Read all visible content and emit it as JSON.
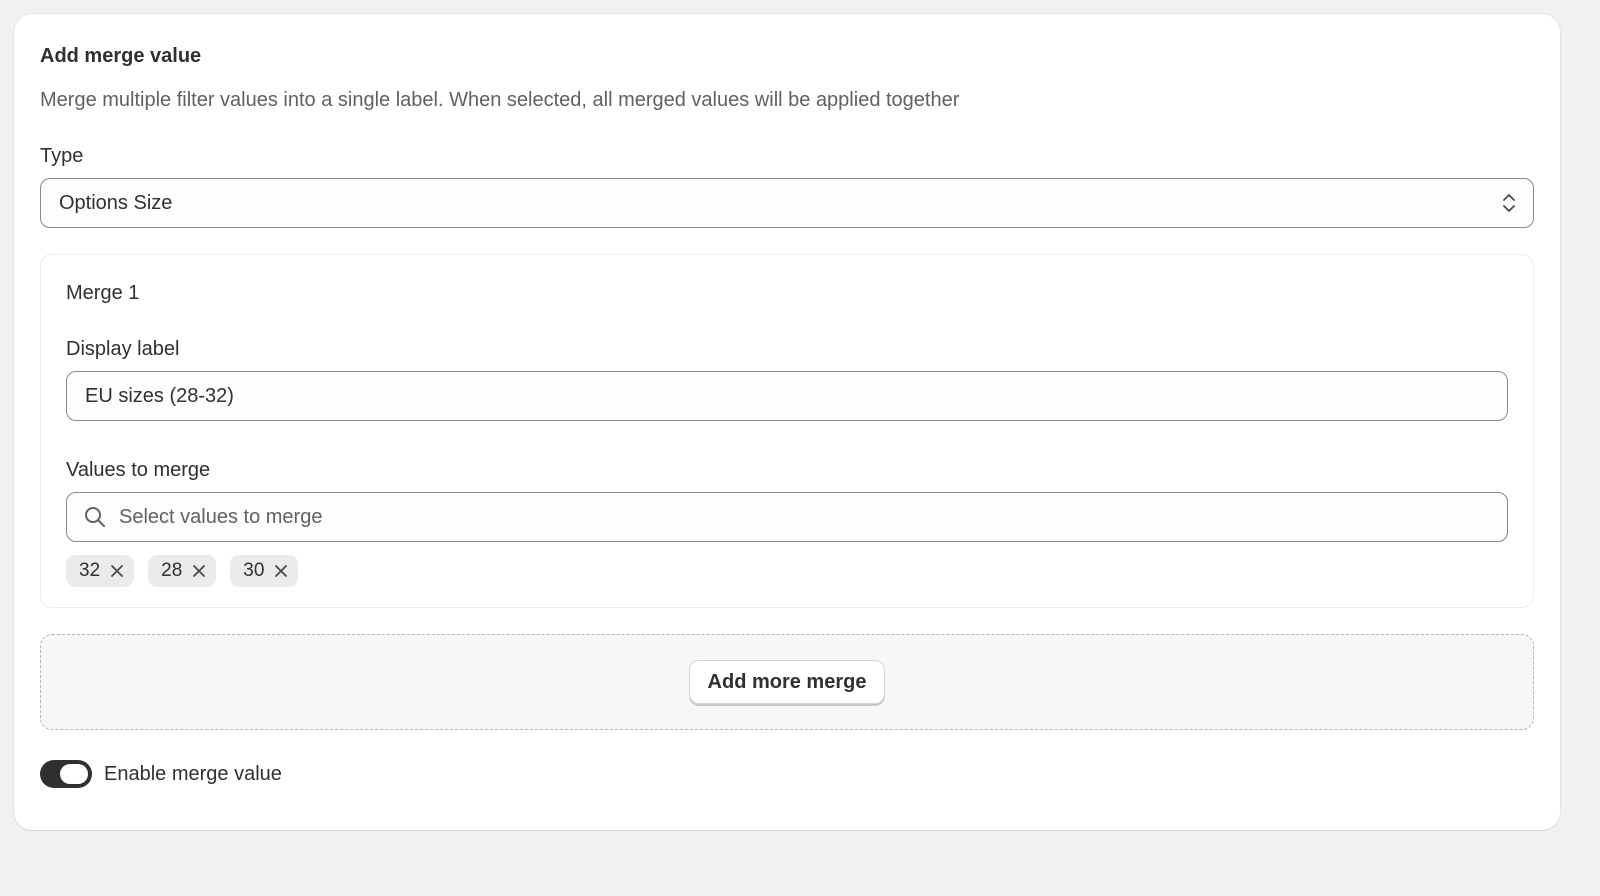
{
  "card": {
    "title": "Add merge value",
    "description": "Merge multiple filter values into a single label. When selected, all merged values will be applied together"
  },
  "type_field": {
    "label": "Type",
    "selected_value": "Options Size"
  },
  "merge": {
    "title": "Merge 1",
    "display_label": {
      "label": "Display label",
      "value": "EU sizes (28-32)"
    },
    "values_to_merge": {
      "label": "Values to merge",
      "placeholder": "Select values to merge",
      "icon": "search-icon",
      "tags": [
        "32",
        "28",
        "30"
      ]
    }
  },
  "add_more": {
    "button_label": "Add more merge"
  },
  "enable_toggle": {
    "label": "Enable merge value",
    "enabled": true
  },
  "colors": {
    "page_background": "#f1f1f1",
    "card_background": "#ffffff",
    "text_primary": "#303030",
    "text_secondary": "#616161",
    "toggle_on": "#303030",
    "tag_background": "#ebebeb"
  }
}
